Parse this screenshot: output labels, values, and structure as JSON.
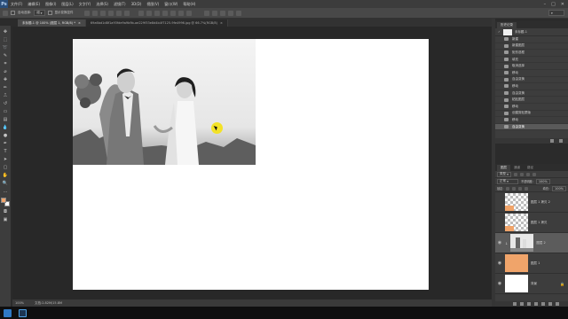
{
  "app": {
    "logo": "Ps",
    "menus": [
      "文件(F)",
      "编辑(E)",
      "图像(I)",
      "图层(L)",
      "文字(Y)",
      "选择(S)",
      "滤镜(T)",
      "3D(D)",
      "视图(V)",
      "窗口(W)",
      "帮助(H)"
    ]
  },
  "options": {
    "auto_select": "自动选择:",
    "group": "组",
    "show_transform": "显示变换控件"
  },
  "tabs": [
    {
      "label": "未标题-1 @ 100% (图层 1, RGB/8) *",
      "close": "×"
    },
    {
      "label": "69a6bd1d8f1a93fde9a9b9b-ae229f33e8d4b4f7125-9fe4996.jpg @ 66.7%(RGB/8)",
      "close": "×"
    }
  ],
  "status": {
    "zoom": "100%",
    "doc": "文档:2.82M/15.8M"
  },
  "history": {
    "tabs": [
      "历史记录"
    ],
    "source": "未标题-1",
    "items": [
      "新建",
      "新建图层",
      "矩形选框",
      "填充",
      "取消选择",
      "移动",
      "自由变换",
      "移动",
      "自由变换",
      "粘贴图层",
      "移动",
      "创建剪贴蒙版",
      "移动",
      "自由变换"
    ],
    "selected_index": 13
  },
  "layers_panel": {
    "tabs": [
      "图层",
      "通道",
      "路径"
    ],
    "kind": "类型",
    "blend_mode": "正常",
    "opacity_label": "不透明度:",
    "opacity": "100%",
    "lock_label": "锁定:",
    "fill_label": "填充:",
    "fill": "100%",
    "layers": [
      {
        "name": "图层 1 拷贝 2",
        "thumb": "checker-orange",
        "visible": false
      },
      {
        "name": "图层 1 拷贝",
        "thumb": "checker-orange",
        "visible": false
      },
      {
        "name": "图层 2",
        "thumb": "photo",
        "visible": true,
        "selected": true
      },
      {
        "name": "图层 1",
        "thumb": "orange",
        "visible": true
      },
      {
        "name": "背景",
        "thumb": "white",
        "visible": true
      }
    ]
  },
  "colors": {
    "foreground": "#f0a46a",
    "background": "#ffffff",
    "cursor": "#f3e227"
  }
}
